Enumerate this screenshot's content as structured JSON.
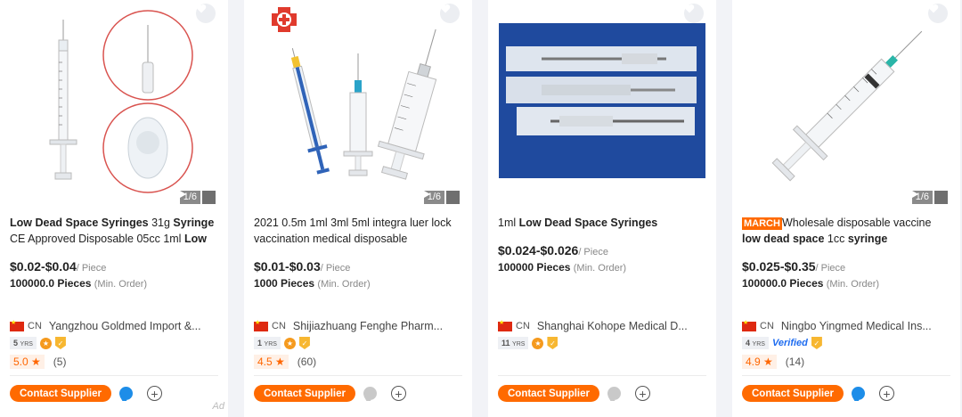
{
  "cards": [
    {
      "title_parts": [
        {
          "text": "Low Dead Space Syringes",
          "bold": true
        },
        {
          "text": " 31g ",
          "bold": false
        },
        {
          "text": "Syringe",
          "bold": true
        },
        {
          "text": " CE Approved Disposable 05cc 1ml ",
          "bold": false
        },
        {
          "text": "Low",
          "bold": true
        }
      ],
      "price": "$0.02-$0.04",
      "price_unit": "/ Piece",
      "moq": "100000.0 Pieces",
      "moq_unit": "(Min. Order)",
      "country": "CN",
      "supplier": "Yangzhou Goldmed Import &...",
      "years": "5",
      "years_label": "YRS",
      "verified": "",
      "rating": "5.0",
      "reviews": "(5)",
      "pager": "1/6",
      "contact_label": "Contact Supplier",
      "chat_online": true,
      "ad_label": "Ad"
    },
    {
      "title_parts": [
        {
          "text": "2021 0.5m 1ml 3ml 5ml integra luer lock vaccination medical disposable",
          "bold": false
        }
      ],
      "price": "$0.01-$0.03",
      "price_unit": "/ Piece",
      "moq": "1000 Pieces",
      "moq_unit": "(Min. Order)",
      "country": "CN",
      "supplier": "Shijiazhuang Fenghe Pharm...",
      "years": "1",
      "years_label": "YRS",
      "verified": "",
      "rating": "4.5",
      "reviews": "(60)",
      "pager": "1/6",
      "contact_label": "Contact Supplier",
      "chat_online": false,
      "ad_label": ""
    },
    {
      "title_parts": [
        {
          "text": "1ml ",
          "bold": false
        },
        {
          "text": "Low Dead Space Syringes",
          "bold": true
        }
      ],
      "price": "$0.024-$0.026",
      "price_unit": "/ Piece",
      "moq": "100000 Pieces",
      "moq_unit": "(Min. Order)",
      "country": "CN",
      "supplier": "Shanghai Kohope Medical D...",
      "years": "11",
      "years_label": "YRS",
      "verified": "",
      "rating": "",
      "reviews": "",
      "pager": "",
      "contact_label": "Contact Supplier",
      "chat_online": false,
      "ad_label": ""
    },
    {
      "title_parts": [
        {
          "text": "MARCH",
          "badge": true
        },
        {
          "text": "Wholesale disposable vaccine ",
          "bold": false
        },
        {
          "text": "low dead space",
          "bold": true
        },
        {
          "text": " 1cc ",
          "bold": false
        },
        {
          "text": "syringe",
          "bold": true
        }
      ],
      "price": "$0.025-$0.35",
      "price_unit": "/ Piece",
      "moq": "100000.0 Pieces",
      "moq_unit": "(Min. Order)",
      "country": "CN",
      "supplier": "Ningbo Yingmed Medical Ins...",
      "years": "4",
      "years_label": "YRS",
      "verified": "Verified",
      "rating": "4.9",
      "reviews": "(14)",
      "pager": "1/6",
      "contact_label": "Contact Supplier",
      "chat_online": true,
      "ad_label": ""
    }
  ],
  "colors": {
    "accent": "#ff6a00",
    "chat_online": "#1d8de8",
    "chat_offline": "#c9c9c9",
    "rating_text": "#ff6600"
  },
  "icons": [
    "heart-icon",
    "play-icon",
    "medal-icon",
    "shield-icon",
    "chat-icon",
    "add-icon",
    "star-icon"
  ]
}
